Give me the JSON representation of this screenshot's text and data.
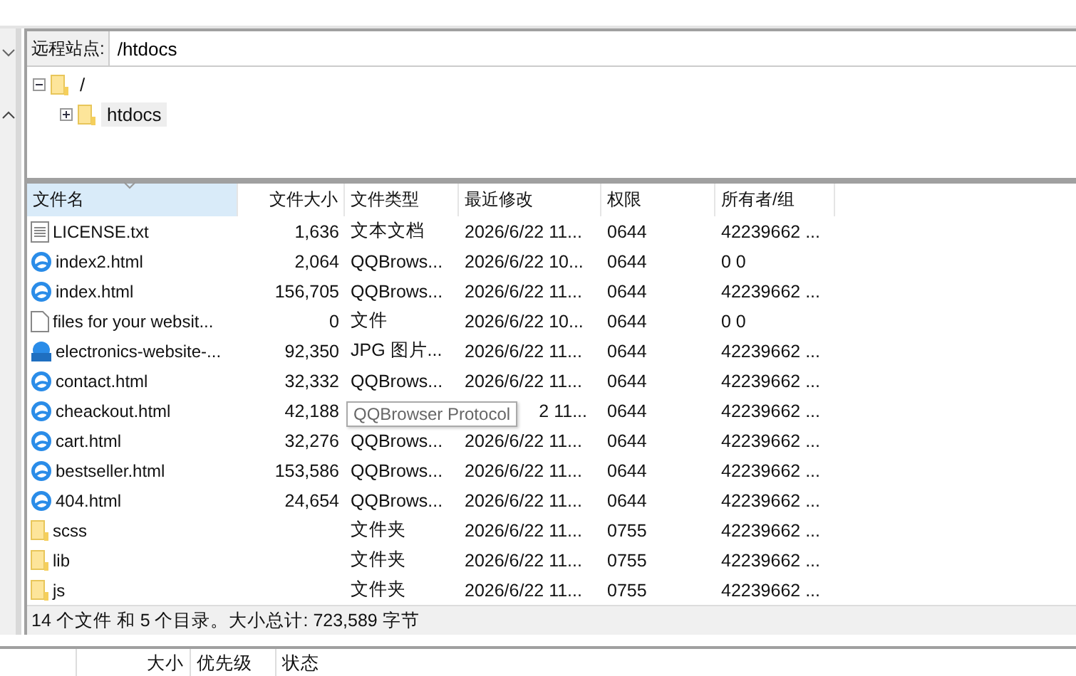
{
  "remote_site": {
    "label": "远程站点:",
    "value": "/htdocs"
  },
  "tree": [
    {
      "label": "/",
      "expanded": true,
      "selected": false,
      "children": [
        {
          "label": "htdocs",
          "expanded": false,
          "selected": true
        }
      ]
    }
  ],
  "table": {
    "columns": [
      {
        "label": "文件名",
        "sorted": true
      },
      {
        "label": "文件大小",
        "sorted": false
      },
      {
        "label": "文件类型",
        "sorted": false
      },
      {
        "label": "最近修改",
        "sorted": false
      },
      {
        "label": "权限",
        "sorted": false
      },
      {
        "label": "所有者/组",
        "sorted": false
      }
    ],
    "rows": [
      {
        "kind": "text",
        "name": "LICENSE.txt",
        "size": "1,636",
        "type": "文本文档",
        "modified": "2026/6/22 11...",
        "permissions": "0644",
        "owner": "42239662 ..."
      },
      {
        "kind": "browser",
        "name": "index2.html",
        "size": "2,064",
        "type": "QQBrows...",
        "modified": "2026/6/22 10...",
        "permissions": "0644",
        "owner": "0 0"
      },
      {
        "kind": "browser",
        "name": "index.html",
        "size": "156,705",
        "type": "QQBrows...",
        "modified": "2026/6/22 11...",
        "permissions": "0644",
        "owner": "42239662 ..."
      },
      {
        "kind": "file",
        "name": "files for your websit...",
        "size": "0",
        "type": "文件",
        "modified": "2026/6/22 10...",
        "permissions": "0644",
        "owner": "0 0"
      },
      {
        "kind": "image",
        "name": "electronics-website-...",
        "size": "92,350",
        "type": "JPG 图片...",
        "modified": "2026/6/22 11...",
        "permissions": "0644",
        "owner": "42239662 ..."
      },
      {
        "kind": "browser",
        "name": "contact.html",
        "size": "32,332",
        "type": "QQBrows...",
        "modified": "2026/6/22 11...",
        "permissions": "0644",
        "owner": "42239662 ..."
      },
      {
        "kind": "browser",
        "name": "cheackout.html",
        "size": "42,188",
        "modified_tail": "2 11...",
        "permissions": "0644",
        "owner": "42239662 ..."
      },
      {
        "kind": "browser",
        "name": "cart.html",
        "size": "32,276",
        "type": "QQBrows...",
        "modified": "2026/6/22 11...",
        "permissions": "0644",
        "owner": "42239662 ..."
      },
      {
        "kind": "browser",
        "name": "bestseller.html",
        "size": "153,586",
        "type": "QQBrows...",
        "modified": "2026/6/22 11...",
        "permissions": "0644",
        "owner": "42239662 ..."
      },
      {
        "kind": "browser",
        "name": "404.html",
        "size": "24,654",
        "type": "QQBrows...",
        "modified": "2026/6/22 11...",
        "permissions": "0644",
        "owner": "42239662 ..."
      },
      {
        "kind": "folder",
        "name": "scss",
        "type": "文件夹",
        "modified": "2026/6/22 11...",
        "permissions": "0755",
        "owner": "42239662 ..."
      },
      {
        "kind": "folder",
        "name": "lib",
        "type": "文件夹",
        "modified": "2026/6/22 11...",
        "permissions": "0755",
        "owner": "42239662 ..."
      },
      {
        "kind": "folder",
        "name": "js",
        "type": "文件夹",
        "modified": "2026/6/22 11...",
        "permissions": "0755",
        "owner": "42239662 ..."
      }
    ]
  },
  "tooltip": "QQBrowser Protocol",
  "status_bar": "14 个文件 和 5 个目录。大小总计: 723,589 字节",
  "queue": {
    "columns": [
      "大小",
      "优先级",
      "状态"
    ]
  }
}
